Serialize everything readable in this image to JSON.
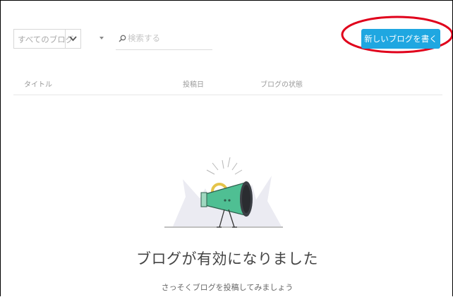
{
  "filters": {
    "blog_select": "すべてのブログ",
    "search_placeholder": "検索する"
  },
  "toolbar": {
    "new_post_label": "新しいブログを書く"
  },
  "table": {
    "columns": [
      "タイトル",
      "投稿日",
      "ブログの状態"
    ]
  },
  "empty_state": {
    "title": "ブログが有効になりました",
    "subtitle": "さっそくブログを投稿してみましょう"
  },
  "colors": {
    "accent": "#1fa7e1",
    "annotation": "#e0001b",
    "megaphone": "#4fbf93"
  }
}
